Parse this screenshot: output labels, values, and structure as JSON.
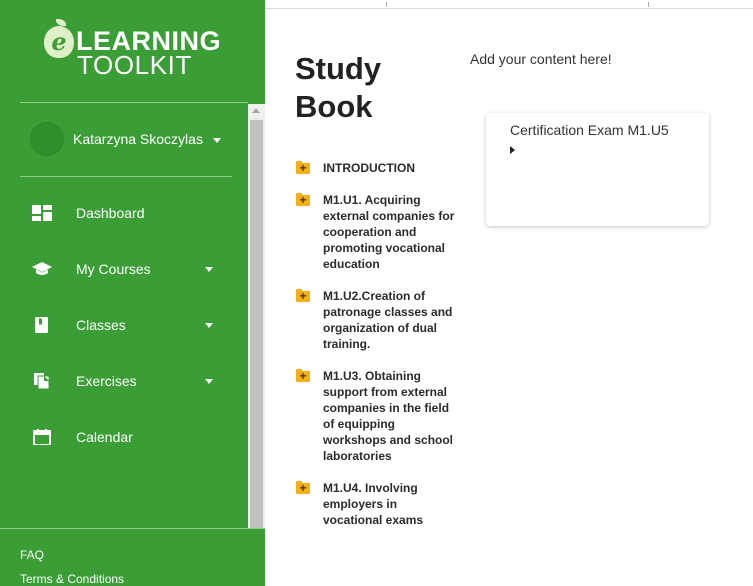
{
  "logo": {
    "e_letter": "e",
    "line1": "LEARNING",
    "line2": "TOOLKIT"
  },
  "user": {
    "name": "Katarzyna Skoczylas"
  },
  "nav": [
    {
      "label": "Dashboard",
      "icon": "dashboard-icon",
      "has_dropdown": false
    },
    {
      "label": "My Courses",
      "icon": "graduation-cap-icon",
      "has_dropdown": true
    },
    {
      "label": "Classes",
      "icon": "book-icon",
      "has_dropdown": true
    },
    {
      "label": "Exercises",
      "icon": "copy-files-icon",
      "has_dropdown": true
    },
    {
      "label": "Calendar",
      "icon": "calendar-icon",
      "has_dropdown": false
    }
  ],
  "footer": {
    "faq": "FAQ",
    "terms": "Terms & Conditions"
  },
  "main": {
    "title": "Study Book",
    "placeholder": "Add your content here!",
    "toc": [
      {
        "label": "INTRODUCTION"
      },
      {
        "label": "M1.U1. Acquiring external companies for cooperation and promoting vocational education"
      },
      {
        "label": "M1.U2.Creation of patronage classes and organization of dual training."
      },
      {
        "label": "M1.U3. Obtaining support from external companies in the field of equipping workshops and school laboratories"
      },
      {
        "label": "M1.U4. Involving employers in vocational exams"
      }
    ],
    "folder_icon_glyph": "+",
    "card": {
      "title": "Certification Exam M1.U5"
    }
  },
  "colors": {
    "sidebar": "#3a9d36",
    "folder": "#f3b01c",
    "text": "#222222"
  }
}
